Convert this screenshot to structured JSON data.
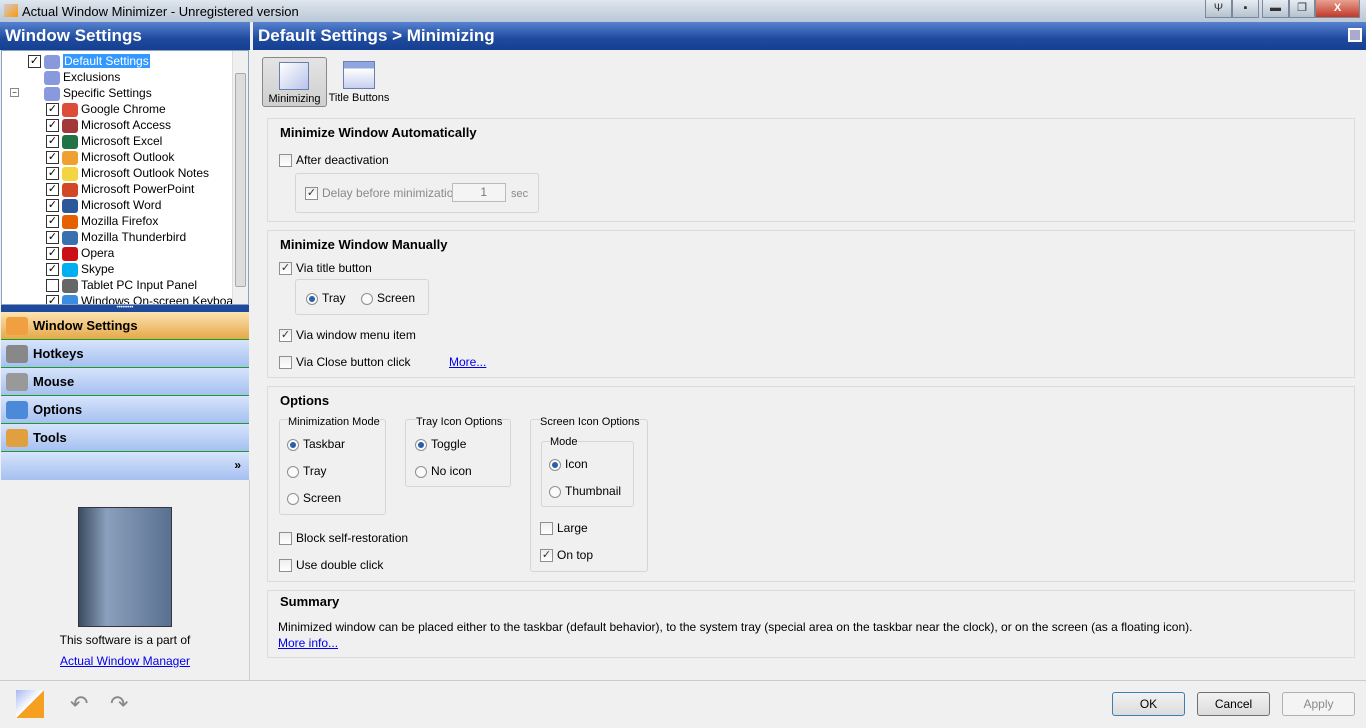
{
  "window": {
    "title": "Actual Window Minimizer - Unregistered version",
    "buttons": [
      "pin",
      "tray",
      "minimize",
      "restore",
      "close"
    ]
  },
  "left": {
    "header": "Window Settings",
    "tree": [
      {
        "label": "Default Settings",
        "checked": true,
        "selected": true,
        "icon": "window-icon"
      },
      {
        "label": "Exclusions",
        "icon": "exclusion-icon"
      },
      {
        "label": "Specific Settings",
        "icon": "specific-icon",
        "expanded": true
      },
      {
        "label": "Google Chrome",
        "checked": true,
        "color": "#dd4b39"
      },
      {
        "label": "Microsoft Access",
        "checked": true,
        "color": "#a4373a"
      },
      {
        "label": "Microsoft Excel",
        "checked": true,
        "color": "#217346"
      },
      {
        "label": "Microsoft Outlook",
        "checked": true,
        "color": "#f0a030"
      },
      {
        "label": "Microsoft Outlook Notes",
        "checked": true,
        "color": "#f5d442"
      },
      {
        "label": "Microsoft PowerPoint",
        "checked": true,
        "color": "#d24726"
      },
      {
        "label": "Microsoft Word",
        "checked": true,
        "color": "#2b579a"
      },
      {
        "label": "Mozilla Firefox",
        "checked": true,
        "color": "#e66000"
      },
      {
        "label": "Mozilla Thunderbird",
        "checked": true,
        "color": "#3a6fb0"
      },
      {
        "label": "Opera",
        "checked": true,
        "color": "#cc0f16"
      },
      {
        "label": "Skype",
        "checked": true,
        "color": "#00aff0"
      },
      {
        "label": "Tablet PC Input Panel",
        "checked": false,
        "color": "#666666"
      },
      {
        "label": "Windows On-screen Keyboard",
        "checked": true,
        "color": "#3b8ede"
      }
    ],
    "nav": [
      {
        "label": "Window Settings",
        "active": true
      },
      {
        "label": "Hotkeys"
      },
      {
        "label": "Mouse"
      },
      {
        "label": "Options"
      },
      {
        "label": "Tools"
      }
    ],
    "promo": {
      "text": "This software is a part of",
      "link": "Actual Window Manager"
    }
  },
  "main": {
    "header": "Default Settings > Minimizing",
    "toolbar": [
      {
        "label": "Minimizing",
        "active": true
      },
      {
        "label": "Title Buttons"
      }
    ],
    "auto": {
      "title": "Minimize Window Automatically",
      "after_deactivation": "After deactivation",
      "delay": "Delay before minimization",
      "delay_value": "1",
      "unit": "sec"
    },
    "manual": {
      "title": "Minimize Window Manually",
      "via_title": "Via title button",
      "tray": "Tray",
      "screen": "Screen",
      "via_menu": "Via window menu item",
      "via_close": "Via Close button click",
      "more": "More..."
    },
    "options": {
      "title": "Options",
      "mode_title": "Minimization Mode",
      "mode": [
        "Taskbar",
        "Tray",
        "Screen"
      ],
      "tray_title": "Tray Icon Options",
      "tray": [
        "Toggle",
        "No icon"
      ],
      "screen_title": "Screen Icon Options",
      "screen_mode_title": "Mode",
      "screen_mode": [
        "Icon",
        "Thumbnail"
      ],
      "large": "Large",
      "ontop": "On top",
      "block": "Block self-restoration",
      "dbl": "Use double click"
    },
    "summary": {
      "title": "Summary",
      "text": "Minimized window can be placed either to the taskbar (default behavior), to the system tray (special area on the taskbar near the clock), or on the screen (as a floating icon).",
      "more": "More info..."
    }
  },
  "footer": {
    "ok": "OK",
    "cancel": "Cancel",
    "apply": "Apply"
  }
}
